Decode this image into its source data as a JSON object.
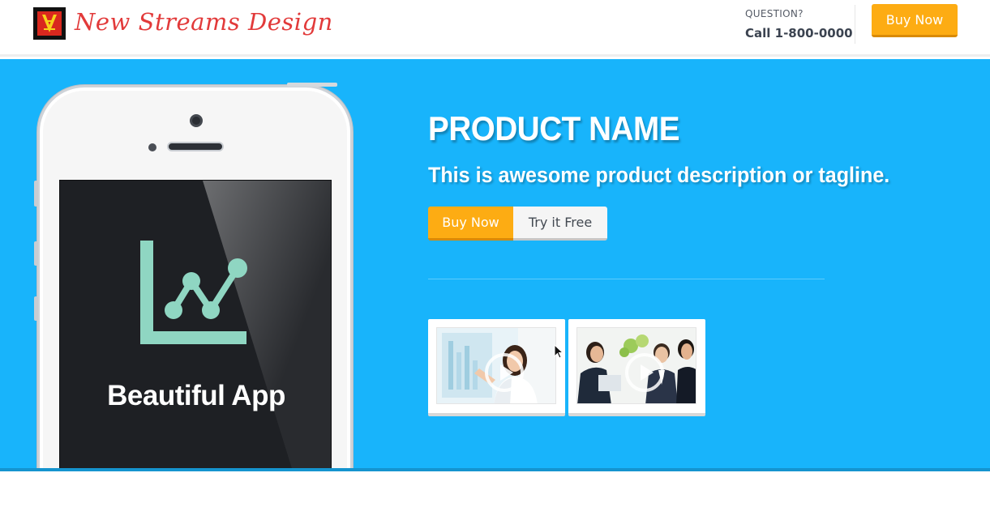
{
  "header": {
    "logo_text": "New Streams Design",
    "question_label": "QUESTION?",
    "phone_label": "Call 1-800-0000",
    "buy_label": "Buy Now"
  },
  "hero": {
    "product_name": "PRODUCT NAME",
    "tagline": "This is awesome product description or tagline.",
    "buy_label": "Buy Now",
    "try_label": "Try it Free",
    "phone_app_title": "Beautiful App",
    "thumbnails": [
      {
        "icon": "play-icon"
      },
      {
        "icon": "play-icon"
      }
    ]
  },
  "colors": {
    "hero_bg": "#18b4fb",
    "accent_orange": "#fdac13",
    "logo_red": "#e23a3a",
    "app_icon_mint": "#8fd6c2"
  }
}
